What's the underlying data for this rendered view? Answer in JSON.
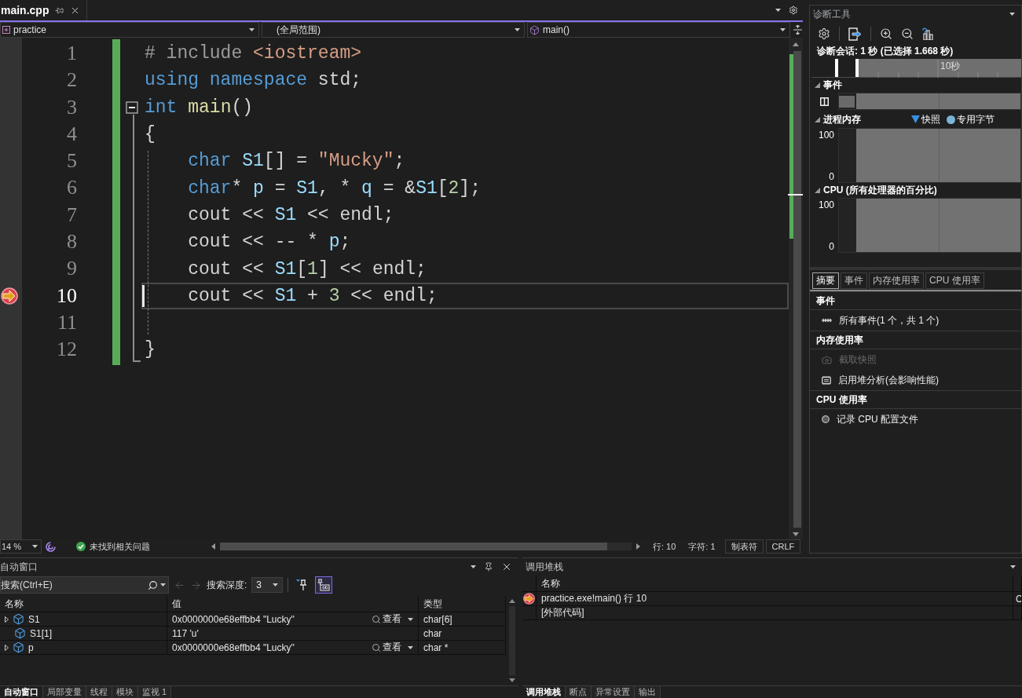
{
  "editor_tabs": [
    {
      "label": "main.cpp",
      "selected": true
    }
  ],
  "navigation_bar": {
    "project": "practice",
    "scope": "(全局范围)",
    "member": "main()"
  },
  "editor": {
    "lines": [
      {
        "number": "1",
        "current": false,
        "breakpoint": false,
        "tokens": [
          {
            "kind": "preprocessor",
            "text": "# include "
          },
          {
            "kind": "include_path",
            "text": "<iostream>"
          }
        ]
      },
      {
        "number": "2",
        "current": false,
        "breakpoint": false,
        "tokens": [
          {
            "kind": "keyword",
            "text": "using namespace"
          },
          {
            "kind": "plain",
            "text": " std;"
          }
        ]
      },
      {
        "number": "3",
        "current": false,
        "breakpoint": false,
        "expanded": true,
        "tokens": [
          {
            "kind": "keyword",
            "text": "int "
          },
          {
            "kind": "function",
            "text": "main"
          },
          {
            "kind": "plain",
            "text": "()"
          }
        ]
      },
      {
        "number": "4",
        "current": false,
        "breakpoint": false,
        "tokens": [
          {
            "kind": "plain",
            "text": "{"
          }
        ]
      },
      {
        "number": "5",
        "current": false,
        "breakpoint": false,
        "tokens": [
          {
            "kind": "keyword",
            "text": "    char "
          },
          {
            "kind": "variable",
            "text": "S1"
          },
          {
            "kind": "plain",
            "text": "[] = "
          },
          {
            "kind": "string",
            "text": "\"Mucky\""
          },
          {
            "kind": "plain",
            "text": ";"
          }
        ]
      },
      {
        "number": "6",
        "current": false,
        "breakpoint": false,
        "tokens": [
          {
            "kind": "keyword",
            "text": "    char"
          },
          {
            "kind": "plain",
            "text": "* "
          },
          {
            "kind": "variable",
            "text": "p"
          },
          {
            "kind": "plain",
            "text": " = "
          },
          {
            "kind": "variable",
            "text": "S1"
          },
          {
            "kind": "plain",
            "text": ", * "
          },
          {
            "kind": "variable",
            "text": "q"
          },
          {
            "kind": "plain",
            "text": " = &"
          },
          {
            "kind": "variable",
            "text": "S1"
          },
          {
            "kind": "plain",
            "text": "["
          },
          {
            "kind": "number",
            "text": "2"
          },
          {
            "kind": "plain",
            "text": "];"
          }
        ]
      },
      {
        "number": "7",
        "current": false,
        "breakpoint": false,
        "tokens": [
          {
            "kind": "plain",
            "text": "    cout << "
          },
          {
            "kind": "variable",
            "text": "S1"
          },
          {
            "kind": "plain",
            "text": " << endl;"
          }
        ]
      },
      {
        "number": "8",
        "current": false,
        "breakpoint": false,
        "tokens": [
          {
            "kind": "plain",
            "text": "    cout << -- * "
          },
          {
            "kind": "variable",
            "text": "p"
          },
          {
            "kind": "plain",
            "text": ";"
          }
        ]
      },
      {
        "number": "9",
        "current": false,
        "breakpoint": false,
        "tokens": [
          {
            "kind": "plain",
            "text": "    cout << "
          },
          {
            "kind": "variable",
            "text": "S1"
          },
          {
            "kind": "plain",
            "text": "["
          },
          {
            "kind": "number",
            "text": "1"
          },
          {
            "kind": "plain",
            "text": "] << endl;"
          }
        ]
      },
      {
        "number": "10",
        "current": true,
        "breakpoint": true,
        "tokens": [
          {
            "kind": "plain",
            "text": "    cout << "
          },
          {
            "kind": "variable",
            "text": "S1"
          },
          {
            "kind": "plain",
            "text": " + "
          },
          {
            "kind": "number",
            "text": "3"
          },
          {
            "kind": "plain",
            "text": " << endl;"
          }
        ]
      },
      {
        "number": "11",
        "current": false,
        "breakpoint": false
      },
      {
        "number": "12",
        "current": false,
        "breakpoint": false,
        "tokens": [
          {
            "kind": "plain",
            "text": "}"
          }
        ]
      }
    ]
  },
  "status_bar": {
    "zoom": "14 %",
    "issues": "未找到相关问题",
    "line": "行: 10",
    "column": "字符: 1",
    "indentation": "制表符",
    "line_ending": "CRLF"
  },
  "diagnostics": {
    "title": "诊断工具",
    "session": "诊断会话: 1 秒 (已选择 1.668 秒)",
    "ruler_label": "10秒",
    "events_lane": {
      "title": "事件"
    },
    "memory": {
      "title": "进程内存",
      "legend": [
        {
          "kind": "snapshot",
          "label": "快照"
        },
        {
          "kind": "bytes",
          "label": "专用字节"
        }
      ],
      "y_max": "100",
      "y_min": "0"
    },
    "cpu": {
      "title": "CPU (所有处理器的百分比)",
      "y_max": "100",
      "y_min": "0"
    },
    "tabs": [
      {
        "label": "摘要",
        "selected": true
      },
      {
        "label": "事件",
        "selected": false
      },
      {
        "label": "内存使用率",
        "selected": false
      },
      {
        "label": "CPU 使用率",
        "selected": false
      }
    ],
    "sections": [
      {
        "title": "事件",
        "items": [
          {
            "kind": "events",
            "label": "所有事件(1 个，共 1 个)",
            "disabled": false
          }
        ]
      },
      {
        "title": "内存使用率",
        "items": [
          {
            "kind": "snapshot",
            "label": "截取快照",
            "disabled": true
          },
          {
            "kind": "heap",
            "label": "启用堆分析(会影响性能)",
            "disabled": false
          }
        ]
      },
      {
        "title": "CPU 使用率",
        "items": [
          {
            "kind": "record",
            "label": "记录 CPU 配置文件",
            "disabled": false
          }
        ]
      }
    ]
  },
  "autos": {
    "title": "自动窗口",
    "search": {
      "placeholder": "搜索(Ctrl+E)"
    },
    "navigation": [
      {
        "kind": "back",
        "disabled": true
      },
      {
        "kind": "forward",
        "disabled": true
      }
    ],
    "depth_label": "搜索深度:",
    "depth": "3",
    "toggles": [
      {
        "kind": "pin",
        "selected": false
      },
      {
        "kind": "text",
        "selected": true
      }
    ],
    "columns": [
      "名称",
      "值",
      "类型"
    ],
    "rows": [
      {
        "name": "S1",
        "expandable": true,
        "value": "0x0000000e68effbb4 \"Lucky\"",
        "view": "查看",
        "type": "char[6]"
      },
      {
        "name": "S1[1]",
        "expandable": false,
        "value": "117 'u'",
        "type": "char"
      },
      {
        "name": "p",
        "expandable": true,
        "value": "0x0000000e68effbb4 \"Lucky\"",
        "view": "查看",
        "type": "char *"
      }
    ],
    "tabs": [
      {
        "label": "自动窗口",
        "selected": true
      },
      {
        "label": "局部变量",
        "selected": false
      },
      {
        "label": "线程",
        "selected": false
      },
      {
        "label": "模块",
        "selected": false
      },
      {
        "label": "监视 1",
        "selected": false
      }
    ]
  },
  "call_stack": {
    "title": "调用堆栈",
    "columns": [
      "名称"
    ],
    "rows": [
      {
        "name": "practice.exe!main() 行 10",
        "current": true,
        "column_3": "C"
      },
      {
        "name": "[外部代码]",
        "current": false
      }
    ],
    "tabs": [
      {
        "label": "调用堆栈",
        "selected": true
      },
      {
        "label": "断点",
        "selected": false
      },
      {
        "label": "异常设置",
        "selected": false
      },
      {
        "label": "输出",
        "selected": false
      }
    ]
  }
}
